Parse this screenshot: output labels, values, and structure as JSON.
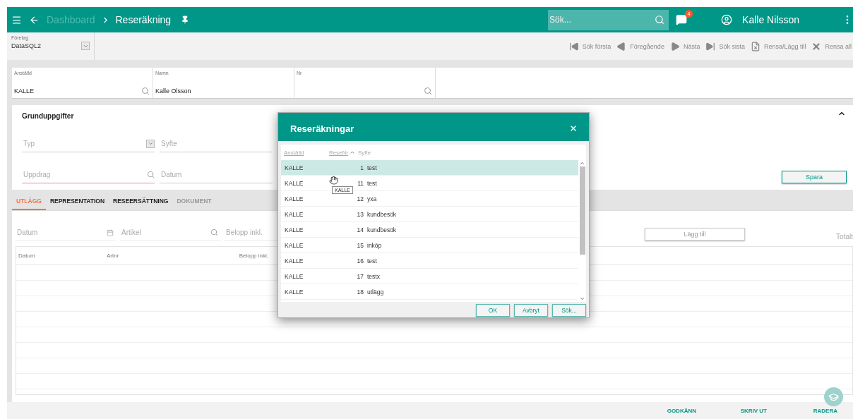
{
  "header": {
    "breadcrumb": [
      {
        "label": "Dashboard",
        "current": false
      },
      {
        "label": "Reseräkning",
        "current": true
      }
    ],
    "search": {
      "placeholder": "Sök..."
    },
    "notifications": "4",
    "user": "Kalle Nilsson"
  },
  "toolbar": {
    "company": {
      "label": "Företag",
      "value": "DataSQL2"
    },
    "actions": [
      {
        "kind": "first",
        "label": "Sök första"
      },
      {
        "kind": "prev",
        "label": "Föregående"
      },
      {
        "kind": "next",
        "label": "Nästa"
      },
      {
        "kind": "last",
        "label": "Sök sista"
      },
      {
        "kind": "clear",
        "label": "Rensa/Lägg till"
      },
      {
        "kind": "clearall",
        "label": "Rensa all"
      }
    ]
  },
  "lookup": [
    {
      "label": "Anställd",
      "value": "KALLE",
      "search": true
    },
    {
      "label": "Namn",
      "value": "Kalle Olsson",
      "search": false
    },
    {
      "label": "Nr",
      "search": true
    }
  ],
  "card": {
    "title": "Grunduppgifter",
    "expanded": true,
    "fields": [
      {
        "kind": "dropdown",
        "placeholder": "Typ",
        "error": false
      },
      {
        "kind": "text",
        "placeholder": "Syfte",
        "error": false
      },
      {
        "kind": "search",
        "placeholder": "Uppdrag",
        "error": true
      },
      {
        "kind": "text",
        "placeholder": "Datum",
        "error": false
      }
    ],
    "save": "Spara"
  },
  "tabs": [
    {
      "label": "UTLÄGG",
      "selected": true,
      "disabled": false
    },
    {
      "label": "REPRESENTATION",
      "selected": false,
      "disabled": false
    },
    {
      "label": "RESEERSÄTTNING",
      "selected": false,
      "disabled": false
    },
    {
      "label": "DOKUMENT",
      "selected": false,
      "disabled": true
    }
  ],
  "entry": {
    "fields": [
      {
        "kind": "date",
        "placeholder": "Datum"
      },
      {
        "kind": "search",
        "placeholder": "Artikel"
      },
      {
        "kind": "text",
        "placeholder": "Belopp inkl."
      }
    ],
    "add": "Lägg till",
    "total": "Totalt"
  },
  "table": {
    "columns": [
      "Datum",
      "Artnr",
      "Belopp inkl."
    ]
  },
  "footer": [
    "GODKÄNN",
    "SKRIV UT",
    "RADERA"
  ],
  "dialog": {
    "title": "Reseräkningar",
    "columns": [
      {
        "label": "Anställd",
        "sorted": false
      },
      {
        "label": "ReseNr",
        "sorted": true
      },
      {
        "label": "Syfte",
        "sorted": false
      }
    ],
    "rows": [
      {
        "employee": "KALLE",
        "nr": "1",
        "purpose": "test",
        "selected": true
      },
      {
        "employee": "KALLE",
        "nr": "11",
        "purpose": "test",
        "selected": false
      },
      {
        "employee": "KALLE",
        "nr": "12",
        "purpose": "yxa",
        "selected": false
      },
      {
        "employee": "KALLE",
        "nr": "13",
        "purpose": "kundbesök",
        "selected": false
      },
      {
        "employee": "KALLE",
        "nr": "14",
        "purpose": "kundbesök",
        "selected": false
      },
      {
        "employee": "KALLE",
        "nr": "15",
        "purpose": "inköp",
        "selected": false
      },
      {
        "employee": "KALLE",
        "nr": "16",
        "purpose": "test",
        "selected": false
      },
      {
        "employee": "KALLE",
        "nr": "17",
        "purpose": "testx",
        "selected": false
      },
      {
        "employee": "KALLE",
        "nr": "18",
        "purpose": "utlägg",
        "selected": false
      }
    ],
    "tooltip": "KALLE",
    "buttons": [
      "OK",
      "Avbryt",
      "Sök..."
    ]
  }
}
